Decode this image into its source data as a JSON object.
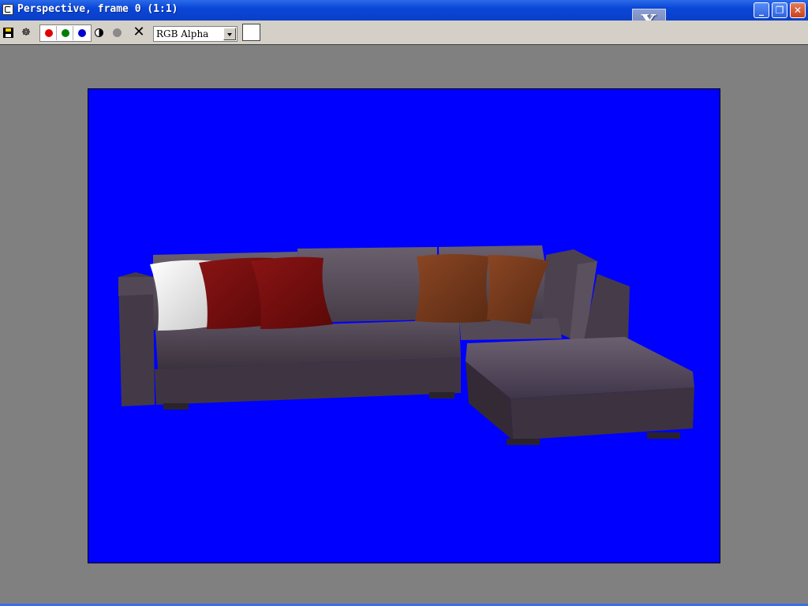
{
  "window": {
    "title": "Perspective, frame 0 (1:1)",
    "controls": {
      "minimize": "_",
      "restore": "❐",
      "close": "✕"
    }
  },
  "overlay": {
    "close_label": "X"
  },
  "toolbar": {
    "icons": [
      "save-icon",
      "clone-icon",
      "red-channel-icon",
      "green-channel-icon",
      "blue-channel-icon",
      "monochrome-icon",
      "gray-dot-icon",
      "clear-icon"
    ],
    "channels": [
      {
        "name": "red",
        "color": "#e00000"
      },
      {
        "name": "green",
        "color": "#008000"
      },
      {
        "name": "blue",
        "color": "#0000d0"
      }
    ],
    "clear_glyph": "✕",
    "channel_select": {
      "value": "RGB Alpha"
    },
    "swatch_color": "#ffffff"
  },
  "render": {
    "background_color": "#0000ff",
    "content": "sofa-render",
    "sofa_color": "#4a3f4c",
    "pillow_colors": [
      "#f2f2f2",
      "#7a0f10",
      "#7a0f10",
      "#7a3a1c",
      "#7a3a1c"
    ]
  }
}
